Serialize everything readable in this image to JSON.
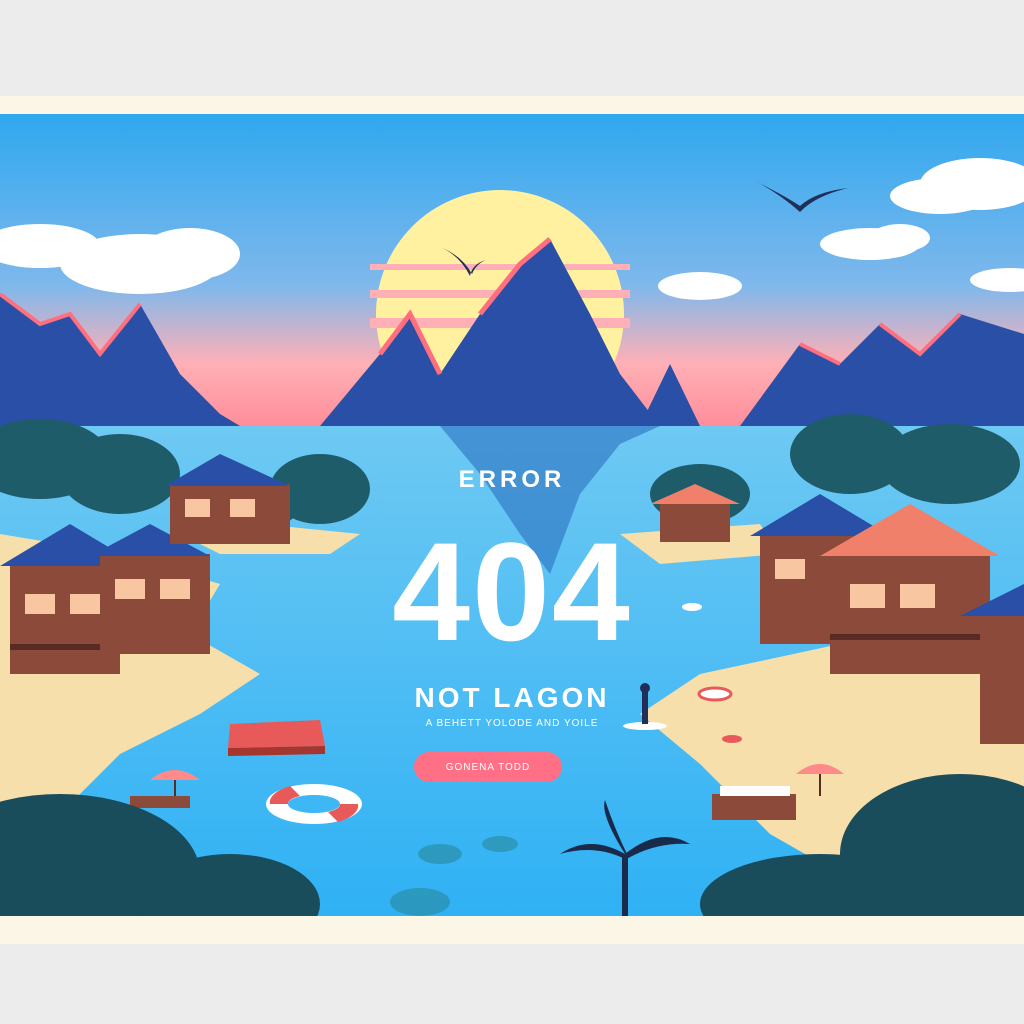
{
  "error_page": {
    "label": "ERROR",
    "code": "404",
    "heading": "NOT LAGON",
    "subtext": "A BEHETT YOLODE AND YOILE",
    "button_label": "GONENA TODD"
  },
  "colors": {
    "sky_top": "#2fa8ef",
    "sky_horizon": "#ff8e9a",
    "sun": "#fff1a0",
    "mountain": "#2a4fa6",
    "mountain_edge": "#ff6f7d",
    "water": "#3db8f5",
    "sand": "#f6dfaa",
    "foliage": "#1f5c6a",
    "button": "#ff6f86",
    "frame": "#fbf6e6"
  }
}
